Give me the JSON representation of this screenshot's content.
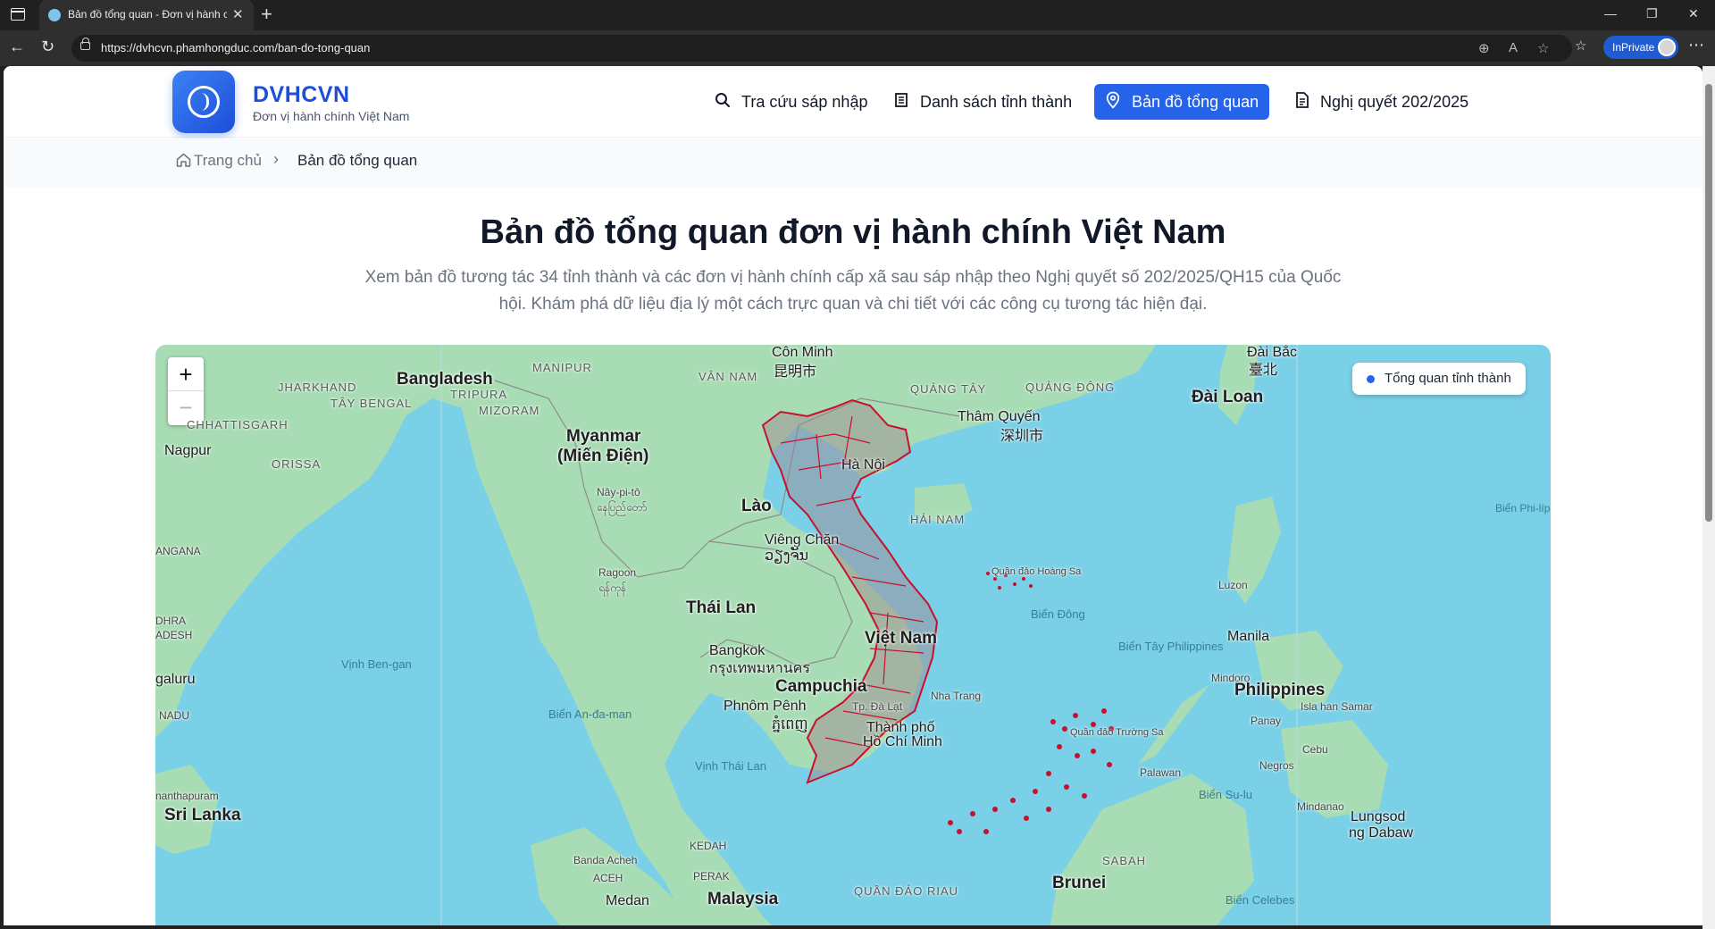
{
  "browser": {
    "tab_title": "Bản đồ tổng quan - Đơn vị hành chính Việt Nam",
    "url": "https://dvhcvn.phamhongduc.com/ban-do-tong-quan",
    "inprivate_label": "InPrivate"
  },
  "site": {
    "brand_name": "DVHCVN",
    "brand_sub": "Đơn vị hành chính Việt Nam",
    "nav": [
      {
        "label": "Tra cứu sáp nhập",
        "icon": "search-icon"
      },
      {
        "label": "Danh sách tỉnh thành",
        "icon": "building-icon"
      },
      {
        "label": "Bản đồ tổng quan",
        "icon": "map-pin-icon",
        "active": true
      },
      {
        "label": "Nghị quyết 202/2025",
        "icon": "document-icon"
      }
    ]
  },
  "breadcrumb": {
    "home": "Trang chủ",
    "current": "Bản đồ tổng quan"
  },
  "hero": {
    "title": "Bản đồ tổng quan đơn vị hành chính Việt Nam",
    "description": "Xem bản đồ tương tác 34 tỉnh thành và các đơn vị hành chính cấp xã sau sáp nhập theo Nghị quyết số 202/2025/QH15 của Quốc hội. Khám phá dữ liệu địa lý một cách trực quan và chi tiết với các công cụ tương tác hiện đại."
  },
  "map": {
    "zoom_in": "+",
    "zoom_out": "−",
    "legend_label": "Tổng quan tỉnh thành",
    "labels": {
      "bangladesh": "Bangladesh",
      "manipur": "MANIPUR",
      "jharkhand": "JHARKHAND",
      "tay_bengal": "TÂY BENGAL",
      "tripura": "TRIPURA",
      "mizoram": "MIZORAM",
      "chhattisgarh": "CHHATTISGARH",
      "nagpur": "Nagpur",
      "orissa": "ORISSA",
      "myanmar": "Myanmar",
      "mien_dien": "(Miến Điện)",
      "naypyidaw": "Nây-pi-tô",
      "naypyidaw_local": "နေပြည်တော်",
      "con_minh": "Côn Minh",
      "con_minh_local": "昆明市",
      "van_nam": "VÂN NAM",
      "quang_tay": "QUẢNG TÂY",
      "quang_dong": "QUẢNG ĐÔNG",
      "tham_quyen": "Thâm Quyến",
      "tham_quyen_local": "深圳市",
      "dai_bac": "Đài Bắc",
      "dai_bac_local": "臺北",
      "dai_loan": "Đài Loan",
      "lao": "Lào",
      "ha_noi": "Hà Nội",
      "hai_nam": "HẢI NAM",
      "vieng_chan": "Viêng Chăn",
      "vieng_chan_local": "ວຽງຈັນ",
      "andhra": "DHRA",
      "desh": "ADESH",
      "angana": "ANGANA",
      "ragoon": "Ragoon",
      "ragoon_local": "ရန်ကုန်",
      "thai_lan": "Thái Lan",
      "viet_nam": "Việt Nam",
      "quan_dao_hoang_sa": "Quần đảo Hoàng Sa",
      "bien_dong": "Biển Đông",
      "luzon": "Luzon",
      "manila": "Manila",
      "bien_tay_philippines": "Biển Tây Philippines",
      "bien_philippin": "Biển Phi-líp-pin",
      "vinh_ben_gan": "Vịnh Ben-gan",
      "bangkok": "Bangkok",
      "bangkok_local": "กรุงเทพมหานคร",
      "campuchia": "Campuchia",
      "phnom_penh": "Phnôm Pênh",
      "phnom_penh_local": "ភ្នំពេញ",
      "nha_trang": "Nha Trang",
      "da_lat": "Tp. Đà Lạt",
      "tp_hcm_1": "Thành phố",
      "tp_hcm_2": "Hồ Chí Minh",
      "galuru": "galuru",
      "nadu": "NADU",
      "bien_andaman": "Biển An-đa-man",
      "vinh_thai_lan": "Vịnh Thái Lan",
      "quan_dao_truong_sa": "Quần đảo Trường Sa",
      "mindoro": "Mindoro",
      "philippines": "Philippines",
      "panay": "Panay",
      "samar": "Isla han Samar",
      "cebu": "Cebu",
      "negros": "Negros",
      "palawan": "Palawan",
      "bien_sulu": "Biển Su-lu",
      "mindanao": "Mindanao",
      "lungsod": "Lungsod",
      "dabaw": "ng Dabaw",
      "thiruvananthapuram": "nanthapuram",
      "sri_lanka": "Sri Lanka",
      "kedah": "KEDAH",
      "banda_aceh": "Banda Acheh",
      "aceh": "ACEH",
      "perak": "PERAK",
      "malaysia": "Malaysia",
      "medan": "Medan",
      "quan_dao_riau": "QUẦN ĐẢO RIAU",
      "sabah": "SABAH",
      "brunei": "Brunei",
      "bien_celebes": "Biển Celebes"
    }
  },
  "colors": {
    "accent": "#2563eb",
    "brand": "#1d4ed8",
    "province_border": "#c8102e",
    "sea": "#7ad0e6",
    "land": "#a8dcb4"
  }
}
